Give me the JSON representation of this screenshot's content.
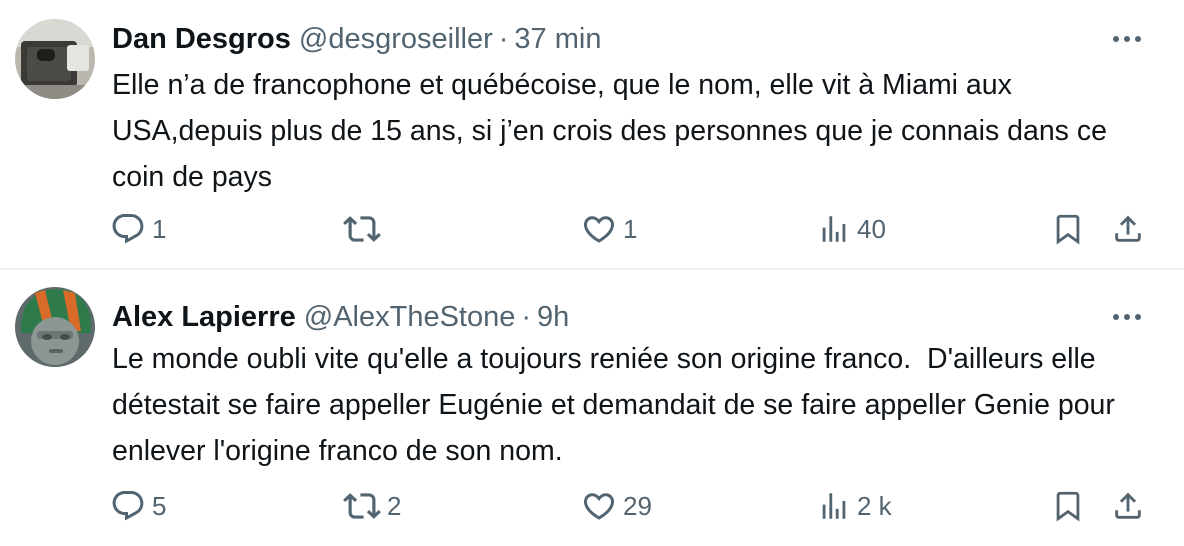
{
  "tweets": [
    {
      "author": {
        "name": "Dan Desgros",
        "handle": "@desgroseiller",
        "avatar_icon": "user-avatar-dan"
      },
      "separator": "·",
      "time": "37 min",
      "text": "Elle n’a de francophone et québécoise, que le nom, elle vit à Miami aux USA,depuis plus de 15 ans, si j’en crois des personnes que je connais dans ce coin de pays",
      "counts": {
        "replies": "1",
        "retweets": "",
        "likes": "1",
        "views": "40"
      }
    },
    {
      "author": {
        "name": "Alex Lapierre",
        "handle": "@AlexTheStone",
        "avatar_icon": "user-avatar-alex"
      },
      "separator": "·",
      "time": "9h",
      "text": "Le monde oubli vite qu'elle a toujours reniée son origine franco.  D'ailleurs elle détestait se faire appeller Eugénie et demandait de se faire appeller Genie pour enlever l'origine franco de son nom.",
      "counts": {
        "replies": "5",
        "retweets": "2",
        "likes": "29",
        "views": "2 k"
      }
    }
  ],
  "colors": {
    "text": "#0f1419",
    "secondary": "#536471",
    "divider": "#eff3f4"
  },
  "icons": [
    "reply-icon",
    "retweet-icon",
    "like-icon",
    "views-icon",
    "bookmark-icon",
    "share-icon",
    "more-icon"
  ]
}
